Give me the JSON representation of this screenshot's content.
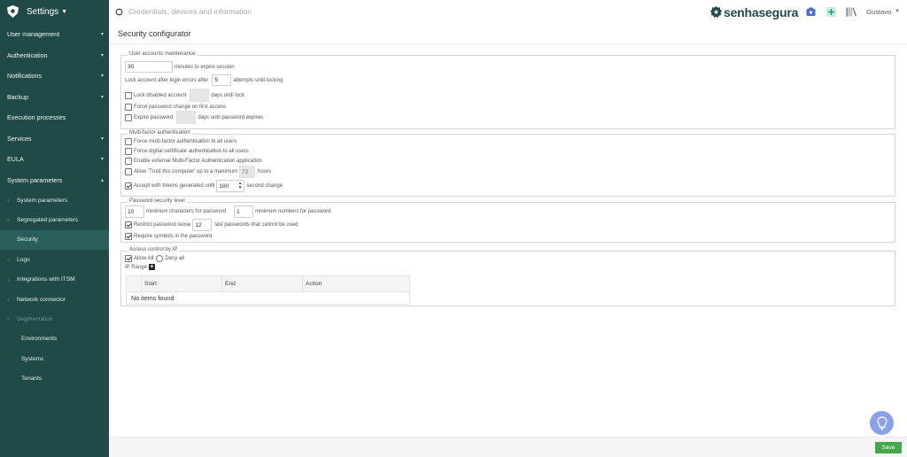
{
  "app": {
    "title": "Settings",
    "brand": "senhasegura",
    "user": "Gustavo"
  },
  "search": {
    "placeholder": "Credentials, devices and information"
  },
  "sidebar": {
    "items": [
      {
        "label": "User management",
        "chevron": true
      },
      {
        "label": "Authentication",
        "chevron": true
      },
      {
        "label": "Notifications",
        "chevron": true
      },
      {
        "label": "Backup",
        "chevron": true
      },
      {
        "label": "Execution processes",
        "chevron": false
      },
      {
        "label": "Services",
        "chevron": true
      },
      {
        "label": "EULA",
        "chevron": true
      },
      {
        "label": "System parameters",
        "chevron": true
      }
    ],
    "subitems": [
      {
        "label": "System parameters"
      },
      {
        "label": "Segregated parameters"
      },
      {
        "label": "Security"
      },
      {
        "label": "Logo"
      },
      {
        "label": "Integrations with ITSM"
      },
      {
        "label": "Network connector"
      },
      {
        "label": "Segmentation"
      }
    ],
    "subsubitems": [
      {
        "label": "Environments"
      },
      {
        "label": "Systems"
      },
      {
        "label": "Tenants"
      }
    ]
  },
  "page": {
    "title": "Security configurator"
  },
  "user_accounts": {
    "legend": "User accounts maintenance",
    "session_minutes": "30",
    "session_label": "minutes to expire session",
    "lock_errors_prefix": "Lock account after login errors after",
    "lock_errors_value": "5",
    "lock_errors_suffix": "attempts until locking",
    "lock_disabled_label": "Lock disabled account",
    "lock_disabled_suffix": "days until lock",
    "force_change_label": "Force password change on first access",
    "expire_password_label": "Expire password",
    "expire_password_suffix": "days until password expires"
  },
  "mfa": {
    "legend": "Multi-factor authentication",
    "force_mfa_label": "Force multi-factor authentication to all users",
    "force_cert_label": "Force digital certificate authentication to all users",
    "external_mfa_label": "Enable external Multi-Factor Authentication application",
    "trust_label": "Allow 'Trust this computer' up to a maximum",
    "trust_value": "72",
    "trust_suffix": "hours",
    "tokens_label": "Accept with tokens generated until",
    "tokens_value": "180",
    "tokens_suffix": "second change"
  },
  "password_security": {
    "legend": "Password security level",
    "min_chars_value": "10",
    "min_chars_label": "minimum characters for password",
    "min_numbers_value": "1",
    "min_numbers_label": "minimum numbers for password.",
    "restrict_label": "Restrict password reuse",
    "restrict_value": "12",
    "restrict_suffix": "last passwords that cannot be used",
    "symbols_label": "Require symbols in the password"
  },
  "ip_access": {
    "legend": "Access control by IP",
    "allow_all": "Allow All",
    "deny_all": "Deny all",
    "ip_range_label": "IP Range",
    "columns": [
      "Start",
      "End",
      "Action"
    ],
    "empty_text": "No items found"
  },
  "footer": {
    "save_label": "Save"
  },
  "colors": {
    "sidebar_bg": "#1f4a48",
    "accent_green": "#46a74a",
    "help_bubble": "#8aa0e8"
  }
}
